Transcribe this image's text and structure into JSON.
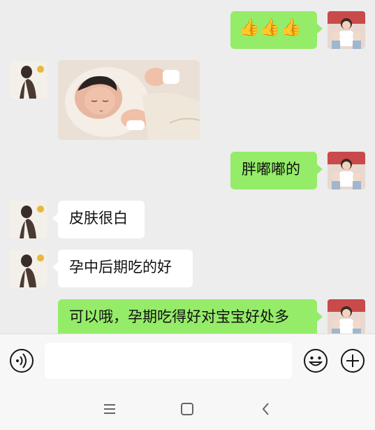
{
  "messages": [
    {
      "from": "me",
      "type": "emoji",
      "content": "👍👍👍"
    },
    {
      "from": "them",
      "type": "image",
      "content": "sleeping-newborn-photo"
    },
    {
      "from": "me",
      "type": "text",
      "content": "胖嘟嘟的"
    },
    {
      "from": "them",
      "type": "text",
      "content": "皮肤很白"
    },
    {
      "from": "them",
      "type": "text",
      "content": "孕中后期吃的好"
    },
    {
      "from": "me",
      "type": "text",
      "content": "可以哦，孕期吃得好对宝宝好处多"
    }
  ],
  "input": {
    "value": "",
    "placeholder": ""
  },
  "icons": {
    "voice": "voice-icon",
    "emoji": "emoji-icon",
    "more": "plus-icon",
    "nav_menu": "menu-icon",
    "nav_home": "home-icon",
    "nav_back": "back-icon"
  },
  "colors": {
    "background": "#ededed",
    "bubble_out": "#95ec69",
    "bubble_in": "#ffffff"
  }
}
